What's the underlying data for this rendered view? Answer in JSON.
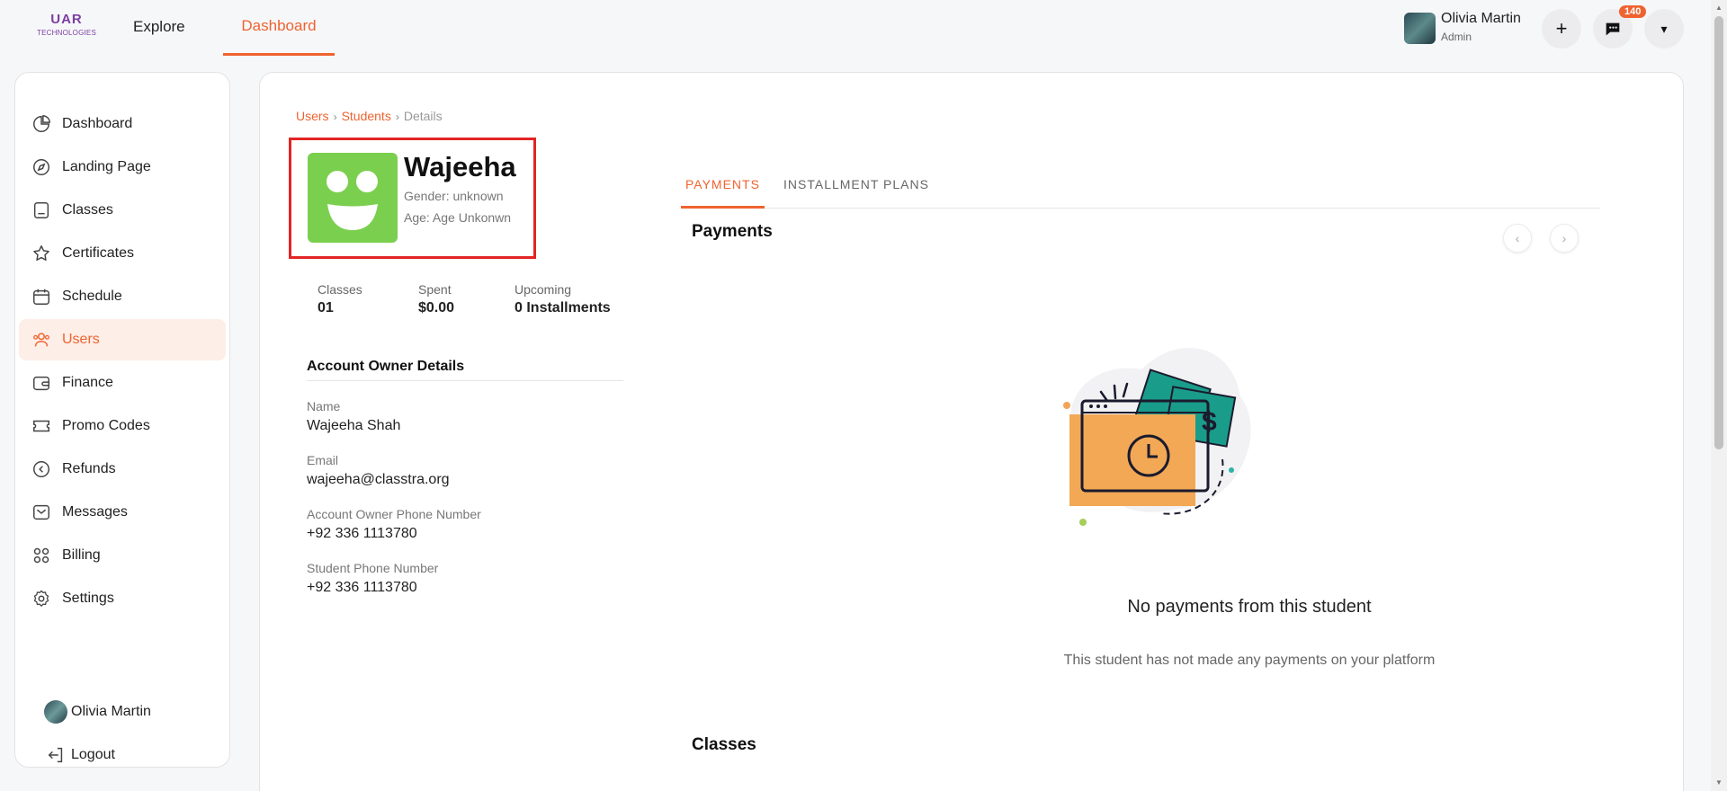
{
  "brand": {
    "logo_main": "UAR",
    "logo_sub": "TECHNOLOGIES"
  },
  "nav": {
    "explore": "Explore",
    "dashboard": "Dashboard"
  },
  "user": {
    "name": "Olivia Martin",
    "role": "Admin"
  },
  "header": {
    "plus": "+",
    "notification_count": "140",
    "menu": "▾"
  },
  "sidebar": {
    "items": [
      {
        "label": "Dashboard",
        "icon": "dashboard-icon"
      },
      {
        "label": "Landing Page",
        "icon": "compass-icon"
      },
      {
        "label": "Classes",
        "icon": "folder-icon"
      },
      {
        "label": "Certificates",
        "icon": "star-icon"
      },
      {
        "label": "Schedule",
        "icon": "calendar-icon"
      },
      {
        "label": "Users",
        "icon": "users-icon",
        "active": true
      },
      {
        "label": "Finance",
        "icon": "wallet-icon"
      },
      {
        "label": "Promo Codes",
        "icon": "ticket-icon"
      },
      {
        "label": "Refunds",
        "icon": "refund-icon"
      },
      {
        "label": "Messages",
        "icon": "mail-icon"
      },
      {
        "label": "Billing",
        "icon": "grid-icon"
      },
      {
        "label": "Settings",
        "icon": "gear-icon"
      }
    ],
    "profile": "Olivia Martin",
    "logout": "Logout"
  },
  "breadcrumb": {
    "users": "Users",
    "students": "Students",
    "details": "Details",
    "sep": "›"
  },
  "student": {
    "name": "Wajeeha",
    "gender": "Gender: unknown",
    "age": "Age: Age Unkonwn"
  },
  "stats": {
    "classes_label": "Classes",
    "classes_value": "01",
    "spent_label": "Spent",
    "spent_value": "$0.00",
    "upcoming_label": "Upcoming",
    "upcoming_value": "0 Installments"
  },
  "owner": {
    "title": "Account Owner Details",
    "name_label": "Name",
    "name_value": "Wajeeha Shah",
    "email_label": "Email",
    "email_value": "wajeeha@classtra.org",
    "phone_label": "Account Owner Phone Number",
    "phone_value": "+92 336 1113780",
    "student_phone_label": "Student Phone Number",
    "student_phone_value": "+92 336 1113780"
  },
  "tabs": {
    "payments": "PAYMENTS",
    "installments": "INSTALLMENT PLANS"
  },
  "payments": {
    "title": "Payments",
    "prev": "‹",
    "next": "›",
    "empty_title": "No payments from this student",
    "empty_sub": "This student has not made any payments on your platform"
  },
  "classes": {
    "title": "Classes"
  },
  "colors": {
    "accent": "#ef6330",
    "avatar_green": "#7bcf4e",
    "highlight": "#e32424"
  }
}
